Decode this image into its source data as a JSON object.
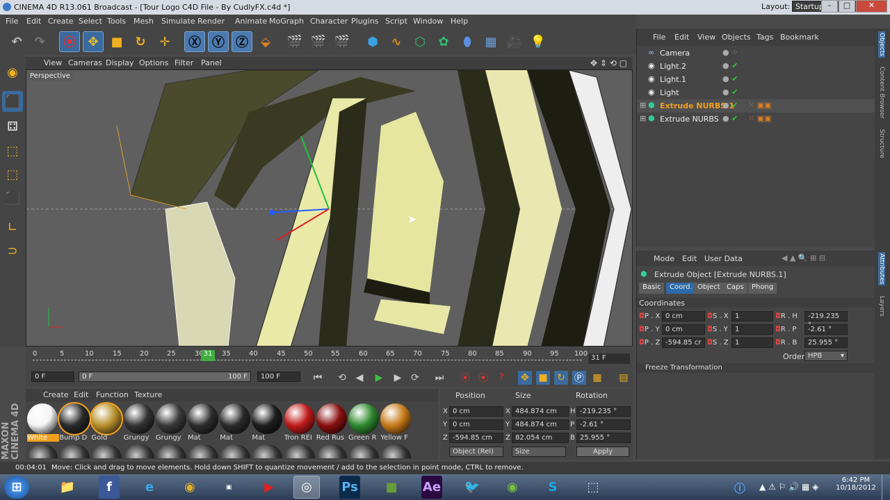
{
  "window": {
    "title": "CINEMA 4D R13.061 Broadcast - [Tour Logo C4D File - By CudlyFX.c4d *]",
    "layout_label": "Layout:",
    "layout_value": "Startup"
  },
  "menubar": [
    "File",
    "Edit",
    "Create",
    "Select",
    "Tools",
    "Mesh",
    "Simulate",
    "Render",
    "Animate",
    "MoGraph",
    "Character",
    "Plugins",
    "Script",
    "Window",
    "Help"
  ],
  "viewport": {
    "menu": [
      "View",
      "Cameras",
      "Display",
      "Options",
      "Filter",
      "Panel"
    ],
    "label": "Perspective"
  },
  "timeline": {
    "ticks": [
      "0",
      "5",
      "10",
      "15",
      "20",
      "25",
      "30",
      "35",
      "40",
      "45",
      "50",
      "55",
      "60",
      "65",
      "70",
      "75",
      "80",
      "85",
      "90",
      "95",
      "100"
    ],
    "current_frame": "31",
    "frame_display": "31 F"
  },
  "playback": {
    "start": "0 F",
    "range_start": "0 F",
    "range_end": "100 F",
    "end": "100 F"
  },
  "materials": {
    "menu": [
      "Create",
      "Edit",
      "Function",
      "Texture"
    ],
    "items": [
      {
        "label": "White",
        "color": "#f4f4f4"
      },
      {
        "label": "Bump D",
        "color": "#2a2a2a"
      },
      {
        "label": "Gold",
        "color": "#b8902c"
      },
      {
        "label": "Grungy",
        "color": "#333"
      },
      {
        "label": "Grungy",
        "color": "#3a3a3a"
      },
      {
        "label": "Mat",
        "color": "#2e2e2e"
      },
      {
        "label": "Mat",
        "color": "#2b2b2b"
      },
      {
        "label": "Mat",
        "color": "#1e1e1e"
      },
      {
        "label": "Tron REI",
        "color": "#c01a1a"
      },
      {
        "label": "Red Rus",
        "color": "#8a1010"
      },
      {
        "label": "Green R",
        "color": "#2f8a2f"
      },
      {
        "label": "Yellow F",
        "color": "#c77a18"
      }
    ]
  },
  "coords": {
    "headers": [
      "Position",
      "Size",
      "Rotation"
    ],
    "rows": [
      {
        "axis": "X",
        "pos": "0 cm",
        "size_axis": "X",
        "size": "484.874 cm",
        "rot_axis": "H",
        "rot": "-219.235 °"
      },
      {
        "axis": "Y",
        "pos": "0 cm",
        "size_axis": "Y",
        "size": "484.874 cm",
        "rot_axis": "P",
        "rot": "-2.61 °"
      },
      {
        "axis": "Z",
        "pos": "-594.85 cm",
        "size_axis": "Z",
        "size": "82.054 cm",
        "rot_axis": "B",
        "rot": "25.955 °"
      }
    ],
    "mode": "Object (Rel)",
    "size_mode": "Size",
    "apply": "Apply"
  },
  "objects": {
    "menu": [
      "File",
      "Edit",
      "View",
      "Objects",
      "Tags",
      "Bookmark"
    ],
    "rows": [
      {
        "name": "Camera",
        "selected": false
      },
      {
        "name": "Light.2",
        "selected": false
      },
      {
        "name": "Light.1",
        "selected": false
      },
      {
        "name": "Light",
        "selected": false
      },
      {
        "name": "Extrude NURBS.1",
        "selected": true
      },
      {
        "name": "Extrude NURBS",
        "selected": false
      }
    ]
  },
  "attributes": {
    "menu": [
      "Mode",
      "Edit",
      "User Data"
    ],
    "title": "Extrude Object [Extrude NURBS.1]",
    "tabs": [
      "Basic",
      "Coord.",
      "Object",
      "Caps",
      "Phong"
    ],
    "section": "Coordinates",
    "rows": [
      {
        "p_lbl": "P . X",
        "p_val": "0 cm",
        "s_lbl": "S . X",
        "s_val": "1",
        "r_lbl": "R . H",
        "r_val": "-219.235 °"
      },
      {
        "p_lbl": "P . Y",
        "p_val": "0 cm",
        "s_lbl": "S . Y",
        "s_val": "1",
        "r_lbl": "R . P",
        "r_val": "-2.61 °"
      },
      {
        "p_lbl": "P . Z",
        "p_val": "-594.85 cr",
        "s_lbl": "S . Z",
        "s_val": "1",
        "r_lbl": "R . B",
        "r_val": "25.955 °"
      }
    ],
    "order_label": "Order",
    "order_value": "HPB",
    "freeze": "Freeze Transformation"
  },
  "side_tabs": [
    "Objects",
    "Content Browser",
    "Structure",
    "Attributes",
    "Layers"
  ],
  "status": {
    "time": "00:04:01",
    "message": "Move: Click and drag to move elements. Hold down SHIFT to quantize movement / add to the selection in point mode, CTRL to remove."
  },
  "branding": "MAXON CINEMA 4D",
  "taskbar": {
    "time": "6:42 PM",
    "date": "10/18/2012"
  }
}
